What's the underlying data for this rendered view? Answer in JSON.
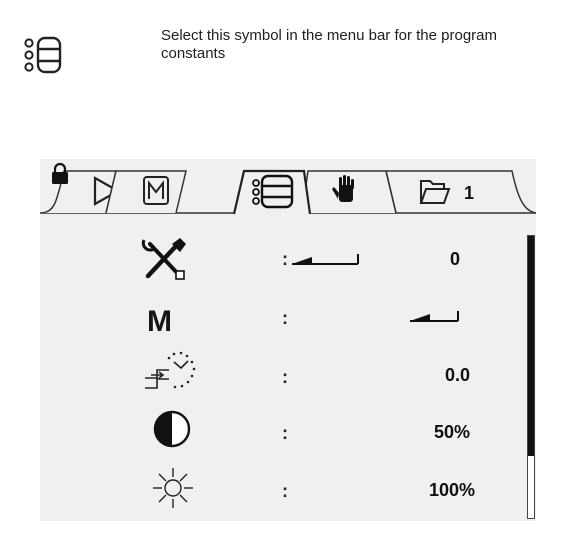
{
  "instruction": {
    "icon": "program-constants-icon",
    "text": "Select this symbol in the menu bar for the program constants"
  },
  "tabs": [
    {
      "id": "play",
      "icon": "play-icon"
    },
    {
      "id": "manual",
      "icon": "m-box-icon"
    },
    {
      "id": "program-constants",
      "icon": "list-icon",
      "active": true
    },
    {
      "id": "hand",
      "icon": "hand-icon"
    },
    {
      "id": "folder",
      "icon": "folder-icon",
      "label": "1"
    }
  ],
  "lock_icon": "lock-icon",
  "rows": [
    {
      "icon": "tools-icon",
      "colon": ":",
      "value": "0",
      "level_shown": "low"
    },
    {
      "icon": "m-letter",
      "label": "M",
      "colon": ":",
      "level_shown": "low"
    },
    {
      "icon": "step-clock-icon",
      "colon": ":",
      "value": "0.0"
    },
    {
      "icon": "contrast-icon",
      "colon": ":",
      "value": "50%"
    },
    {
      "icon": "brightness-icon",
      "colon": ":",
      "value": "100%"
    }
  ],
  "scrollbar": {
    "position": "top",
    "thumb_fraction": 0.78
  }
}
